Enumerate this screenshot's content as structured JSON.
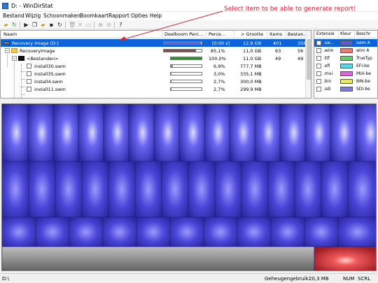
{
  "window": {
    "title": "D: - WinDirStat"
  },
  "annotation": {
    "text": "Select item to be able to generate report!"
  },
  "menu": [
    "Bestand",
    "Wijzig",
    "Schoonmaken",
    "Boomkaart",
    "Rapport",
    "Opties",
    "Help"
  ],
  "toolbar": {
    "icons": [
      "open-icon",
      "refresh-icon",
      "play-icon",
      "copy-icon",
      "explorer-icon",
      "terminal-icon",
      "refresh-selected-icon",
      "delete-to-bin-icon",
      "delete-icon",
      "properties-icon",
      "zoom-in-icon",
      "zoom-out-icon",
      "help-icon"
    ]
  },
  "tree": {
    "columns": [
      "Naam",
      "Deelboom Perc...",
      "Perce...",
      "> Grootte",
      "Items",
      "Bestan..."
    ],
    "rows": [
      {
        "name": "Recovery Image (D:)",
        "percent": "[0:00 s]",
        "size": "12,9 GB",
        "items": "401",
        "files": "358",
        "fill": 0.99,
        "barColor": "#5b6cc7",
        "selected": true
      },
      {
        "name": "RecoveryImage",
        "percent": "85,1%",
        "size": "11,0 GB",
        "items": "63",
        "files": "56",
        "fill": 0.851,
        "barColor": "#8b4a4a",
        "selected": false
      },
      {
        "name": "<Bestanden>",
        "percent": "100,0%",
        "size": "11,0 GB",
        "items": "49",
        "files": "49",
        "fill": 1.0,
        "barColor": "#3c8a3c",
        "selected": false
      },
      {
        "name": "install30.swm",
        "percent": "6,9%",
        "size": "777,7 MB",
        "items": "",
        "files": "",
        "fill": 0.069,
        "barColor": "#888888",
        "selected": false
      },
      {
        "name": "install35.swm",
        "percent": "3,0%",
        "size": "335,1 MB",
        "items": "",
        "files": "",
        "fill": 0.03,
        "barColor": "#888888",
        "selected": false
      },
      {
        "name": "install4.swm",
        "percent": "2,7%",
        "size": "300,0 MB",
        "items": "",
        "files": "",
        "fill": 0.027,
        "barColor": "#888888",
        "selected": false
      },
      {
        "name": "install11.swm",
        "percent": "2,7%",
        "size": "299,9 MB",
        "items": "",
        "files": "",
        "fill": 0.027,
        "barColor": "#888888",
        "selected": false
      }
    ]
  },
  "extensions": {
    "columns": [
      "Extensie",
      "Kleur",
      "Beschr"
    ],
    "rows": [
      {
        "ext": ".sw...",
        "desc": "swm A",
        "color": "#5a5ae8",
        "selected": true
      },
      {
        "ext": ".wim",
        "desc": "wim A",
        "color": "#e87a7a",
        "selected": false
      },
      {
        "ext": ".ttf",
        "desc": "TrueTyp",
        "color": "#5ad45a",
        "selected": false
      },
      {
        "ext": ".efi",
        "desc": "EFI-be",
        "color": "#5ad8e8",
        "selected": false
      },
      {
        "ext": ".mui",
        "desc": "MUI-be",
        "color": "#e85ae8",
        "selected": false
      },
      {
        "ext": ".bin",
        "desc": "BIN-be",
        "color": "#e8e85a",
        "selected": false
      },
      {
        "ext": ".sdi",
        "desc": "SDI-be",
        "color": "#7a7ae8",
        "selected": false
      }
    ]
  },
  "status": {
    "path": "D:\\",
    "memory_label": "Geheugengebruik:",
    "memory_value": "20,3 MB",
    "num": "NUM",
    "scrl": "SCRL"
  },
  "colors": {
    "selection": "#0a64d8",
    "annotation": "#d2282e",
    "treemap_blue": "#3b39d8",
    "treemap_red": "#e8404a",
    "treemap_gray": "#9a9a9a"
  }
}
